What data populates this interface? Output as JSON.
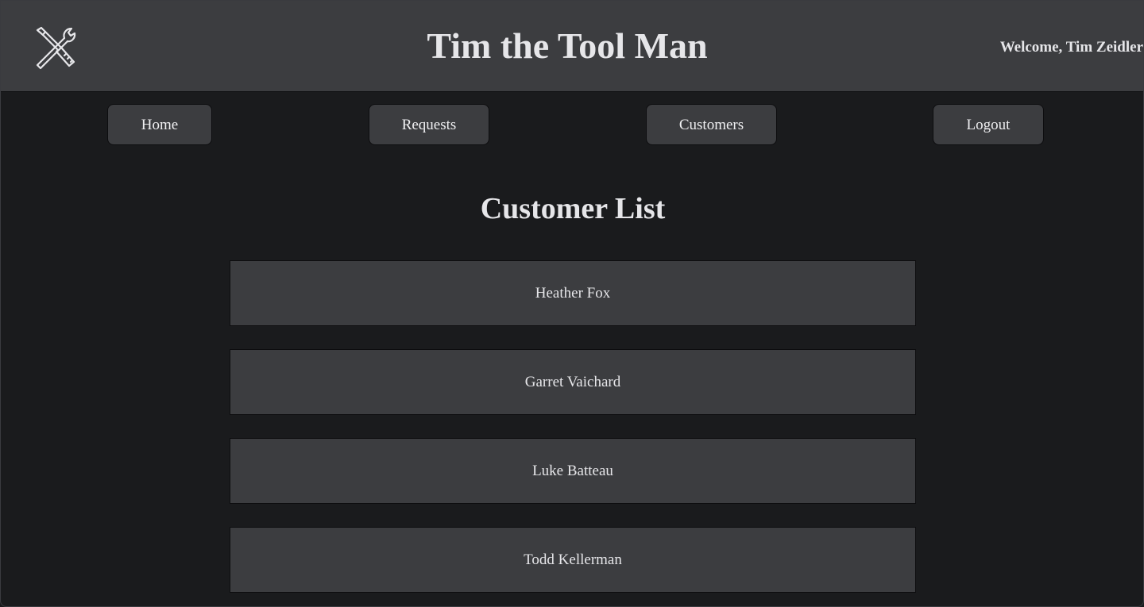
{
  "header": {
    "logo_icon": "wrench-screwdriver-icon",
    "title": "Tim the Tool Man",
    "welcome": "Welcome, Tim Zeidler"
  },
  "nav": {
    "home": "Home",
    "requests": "Requests",
    "customers": "Customers",
    "logout": "Logout"
  },
  "main": {
    "title": "Customer List",
    "customers": [
      "Heather Fox",
      "Garret Vaichard",
      "Luke Batteau",
      "Todd Kellerman"
    ]
  },
  "colors": {
    "background": "#1a1b1d",
    "surface": "#3c3d40",
    "text": "#e6e6e9",
    "border": "#0d0d0f"
  }
}
